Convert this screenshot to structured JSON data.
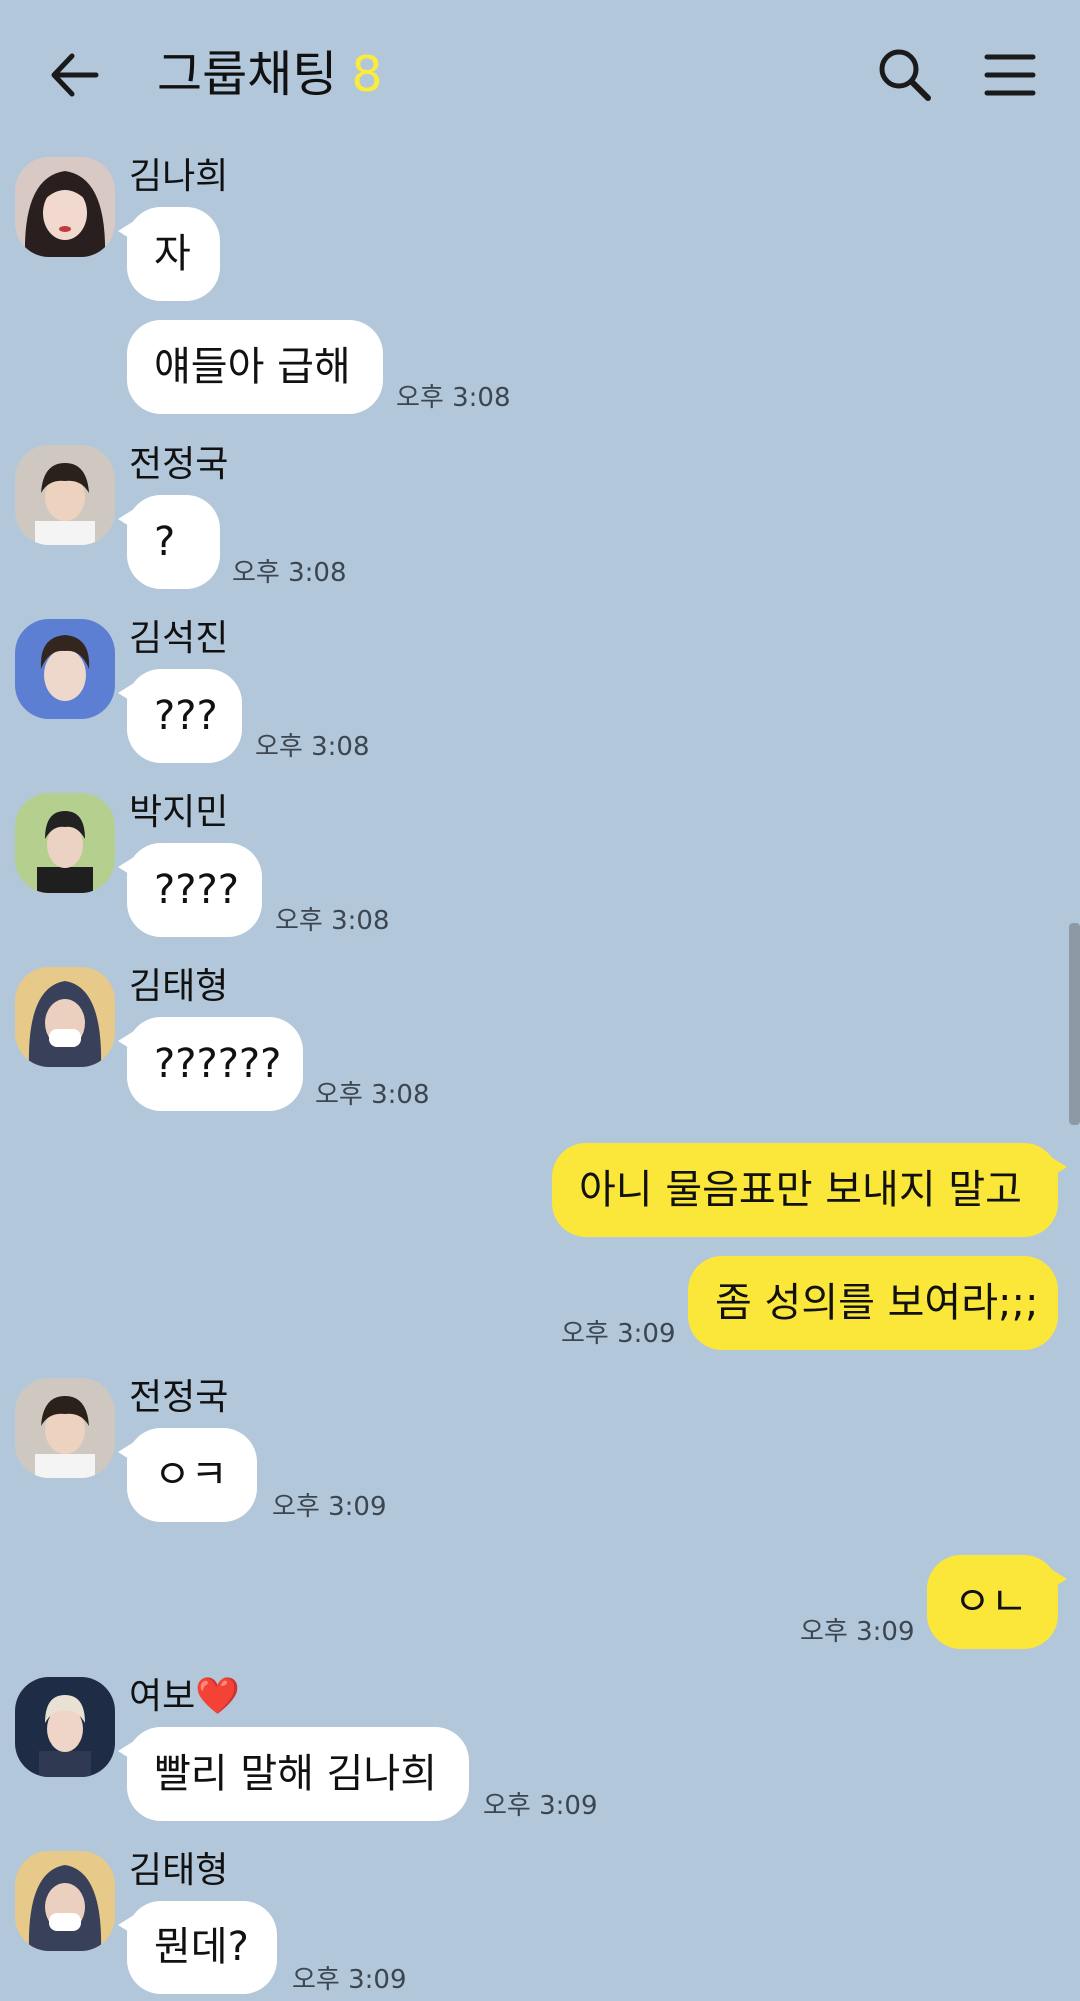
{
  "header": {
    "title": "그룹채팅",
    "member_count": "8"
  },
  "icons": {
    "back": "arrow-left-icon",
    "search": "search-icon",
    "menu": "hamburger-menu-icon"
  },
  "colors": {
    "background": "#b2c7da",
    "my_bubble": "#fbe63a",
    "other_bubble": "#ffffff",
    "member_count": "#fbeb3a"
  },
  "messages": [
    {
      "sender": "김나희",
      "text": "자"
    },
    {
      "text": "얘들아 급해",
      "time": "오후 3:08"
    },
    {
      "sender": "전정국",
      "text": "?",
      "time": "오후 3:08"
    },
    {
      "sender": "김석진",
      "text": "???",
      "time": "오후 3:08"
    },
    {
      "sender": "박지민",
      "text": "????",
      "time": "오후 3:08"
    },
    {
      "sender": "김태형",
      "text": "??????",
      "time": "오후 3:08"
    },
    {
      "text": "아니 물음표만 보내지 말고",
      "mine": true
    },
    {
      "text": "좀 성의를 보여라;;;",
      "time": "오후 3:09",
      "mine": true
    },
    {
      "sender": "전정국",
      "text": "ㅇㅋ",
      "time": "오후 3:09"
    },
    {
      "text": "ㅇㄴ",
      "time": "오후 3:09",
      "mine": true
    },
    {
      "sender": "여보❤️",
      "text": "빨리 말해 김나희",
      "time": "오후 3:09"
    },
    {
      "sender": "김태형",
      "text": "뭔데?",
      "time": "오후 3:09"
    }
  ]
}
